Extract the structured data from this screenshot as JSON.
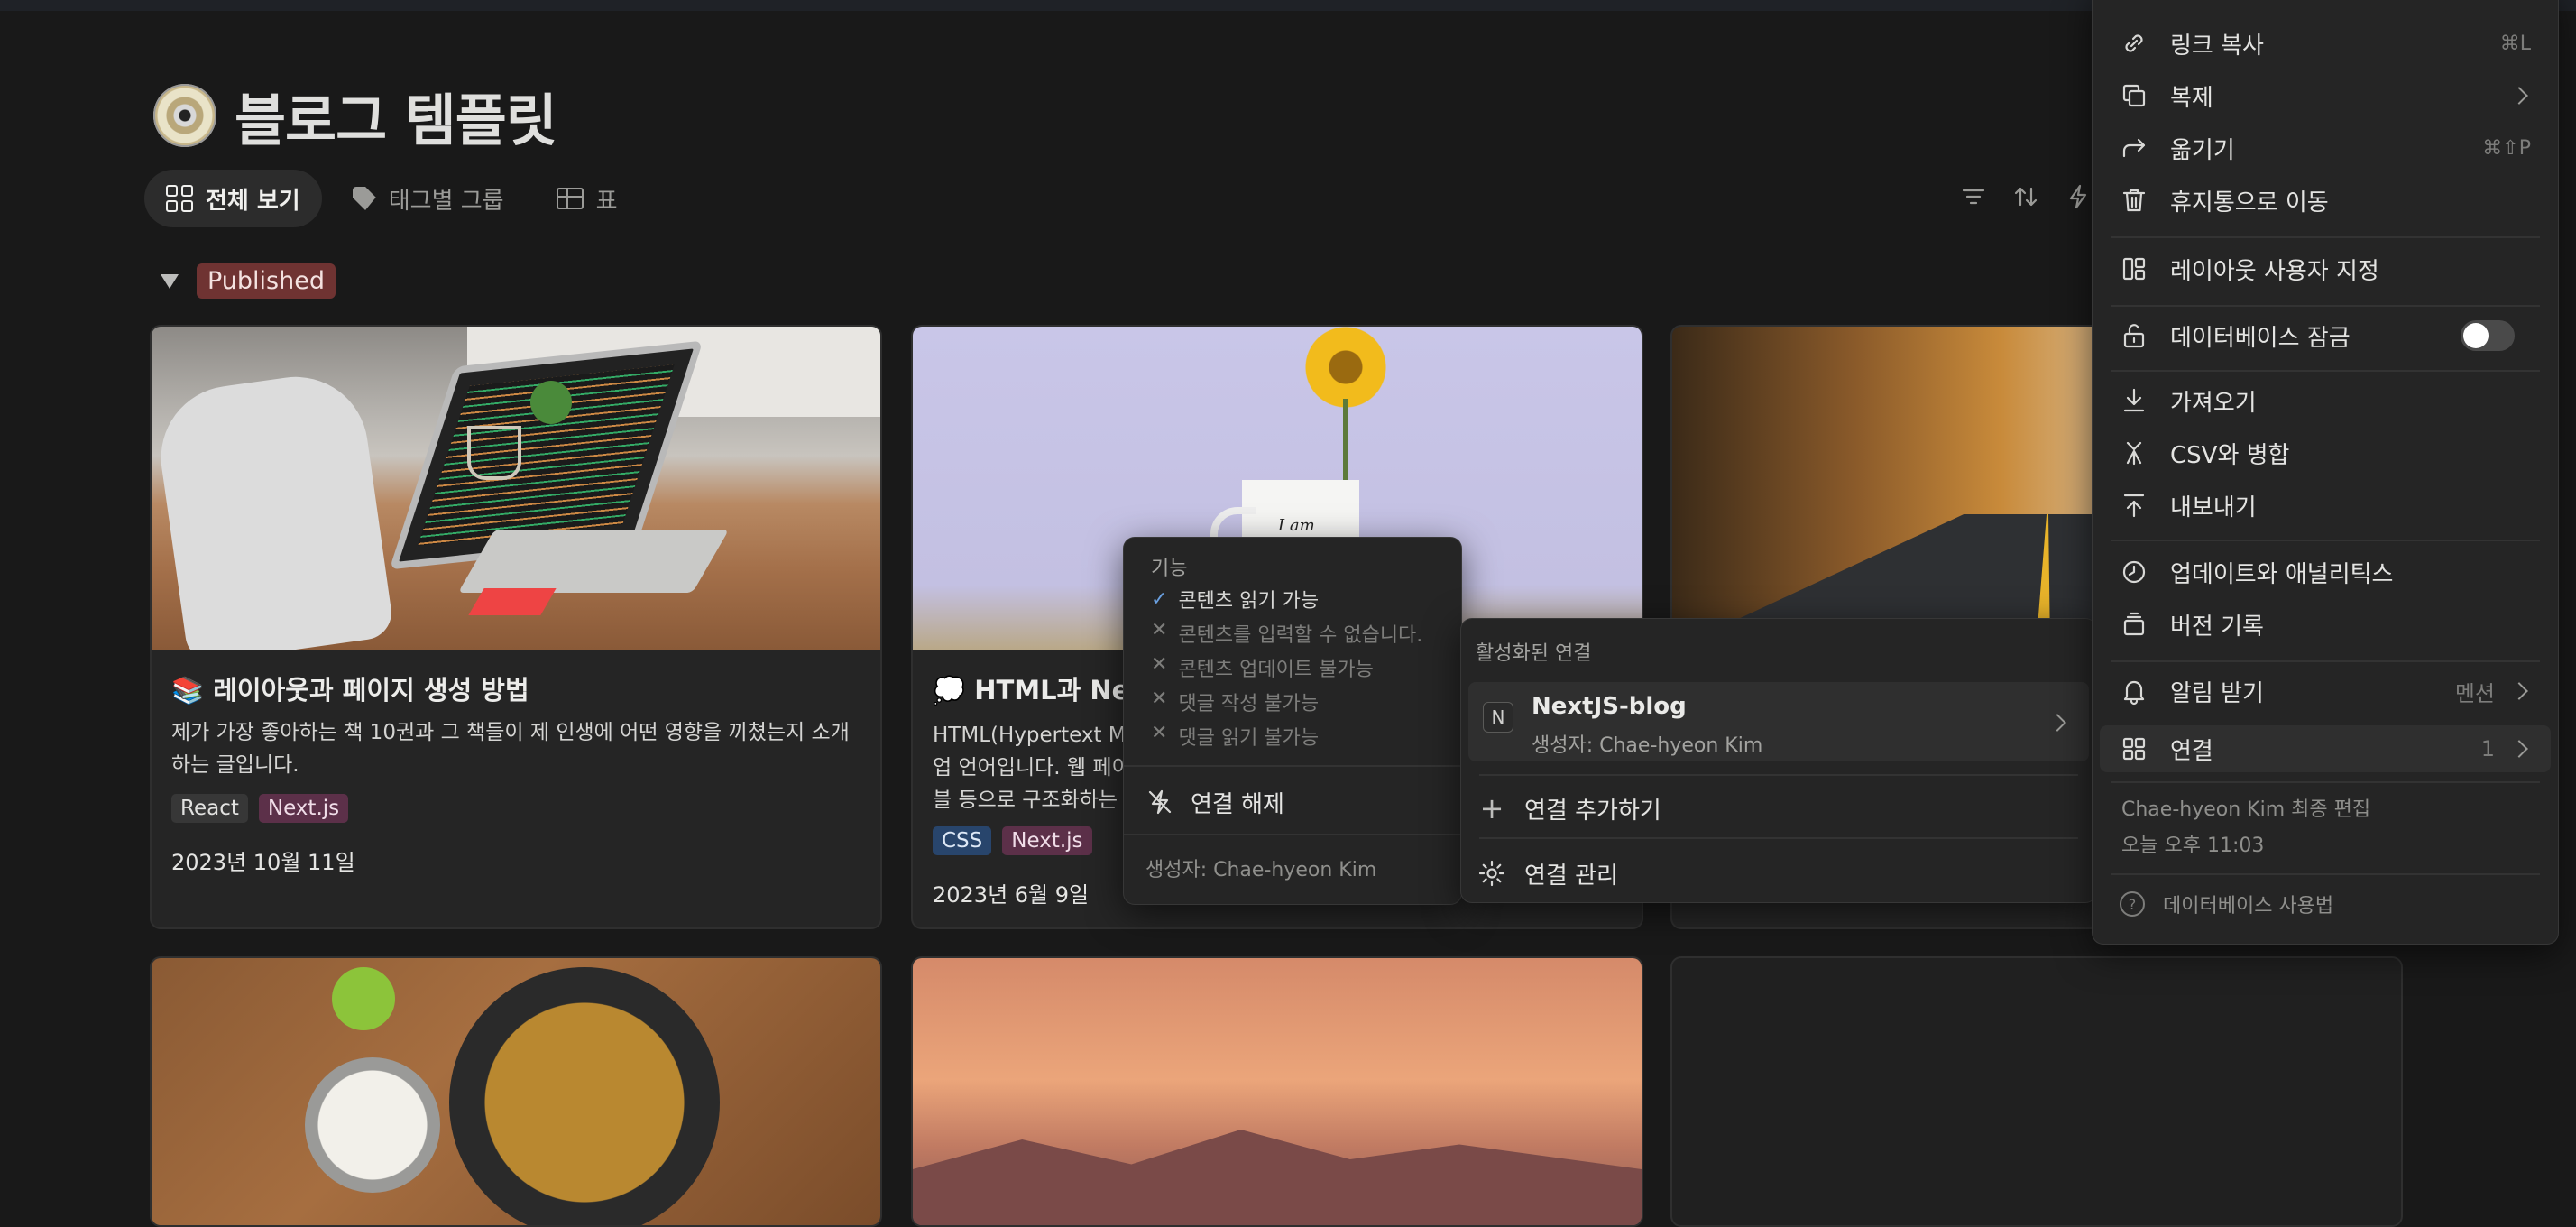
{
  "page": {
    "title": "블로그 템플릿",
    "tabs": [
      {
        "label": "전체 보기",
        "icon": "gallery-icon"
      },
      {
        "label": "태그별 그룹",
        "icon": "tag-icon"
      },
      {
        "label": "표",
        "icon": "table-icon"
      }
    ],
    "group": {
      "label": "Published",
      "color": "#6f3332"
    }
  },
  "cards": [
    {
      "emoji": "📚",
      "title": "레이아웃과 페이지 생성 방법",
      "desc": "제가 가장 좋아하는 책 10권과 그 책들이 제 인생에 어떤 영향을 끼쳤는지 소개하는 글입니다.",
      "tags": [
        "React",
        "Next.js"
      ],
      "date": "2023년 10월 11일"
    },
    {
      "emoji": "💭",
      "title": "HTML과 Nex",
      "desc": "HTML(Hypertext M 업 언어입니다. 웹 페이 블 등으로 구조화하는 다",
      "desc_lines": [
        "HTML(Hypertext M",
        "업 언어입니다. 웹 페이",
        "블 등으로 구조화하는 다"
      ],
      "mug_text": "I am",
      "tags": [
        "CSS",
        "Next.js"
      ],
      "date": "2023년 6월 9일"
    }
  ],
  "capabilities_menu": {
    "header": "기능",
    "items": [
      {
        "label": "콘텐츠 읽기 가능",
        "enabled": true
      },
      {
        "label": "콘텐츠를 입력할 수 없습니다.",
        "enabled": false
      },
      {
        "label": "콘텐츠 업데이트 불가능",
        "enabled": false
      },
      {
        "label": "댓글 작성 불가능",
        "enabled": false
      },
      {
        "label": "댓글 읽기 불가능",
        "enabled": false
      }
    ],
    "disconnect": "연결 해제",
    "creator": "생성자: Chae-hyeon Kim"
  },
  "connections_menu": {
    "header": "활성화된 연결",
    "connection": {
      "badge": "N",
      "name": "NextJS-blog",
      "creator": "생성자: Chae-hyeon Kim"
    },
    "add": "연결 추가하기",
    "manage": "연결 관리"
  },
  "main_menu": {
    "items": [
      {
        "label": "링크 복사",
        "shortcut": "⌘L",
        "icon": "link-icon"
      },
      {
        "label": "복제",
        "icon": "duplicate-icon"
      },
      {
        "label": "옮기기",
        "shortcut": "⌘⇧P",
        "icon": "move-icon"
      },
      {
        "label": "휴지통으로 이동",
        "icon": "trash-icon"
      },
      {
        "label": "레이아웃 사용자 지정",
        "icon": "layout-icon"
      },
      {
        "label": "데이터베이스 잠금",
        "icon": "lock-icon",
        "toggle": false
      },
      {
        "label": "가져오기",
        "icon": "import-icon"
      },
      {
        "label": "CSV와 병합",
        "icon": "merge-icon"
      },
      {
        "label": "내보내기",
        "icon": "export-icon"
      },
      {
        "label": "업데이트와 애널리틱스",
        "icon": "clock-icon"
      },
      {
        "label": "버전 기록",
        "icon": "history-icon"
      },
      {
        "label": "알림 받기",
        "value": "멘션",
        "icon": "bell-icon"
      },
      {
        "label": "연결",
        "value": "1",
        "icon": "connections-icon"
      }
    ],
    "footer": {
      "edited_by": "Chae-hyeon Kim 최종 편집",
      "edited_time": "오늘 오후 11:03",
      "help": "데이터베이스 사용법"
    }
  }
}
